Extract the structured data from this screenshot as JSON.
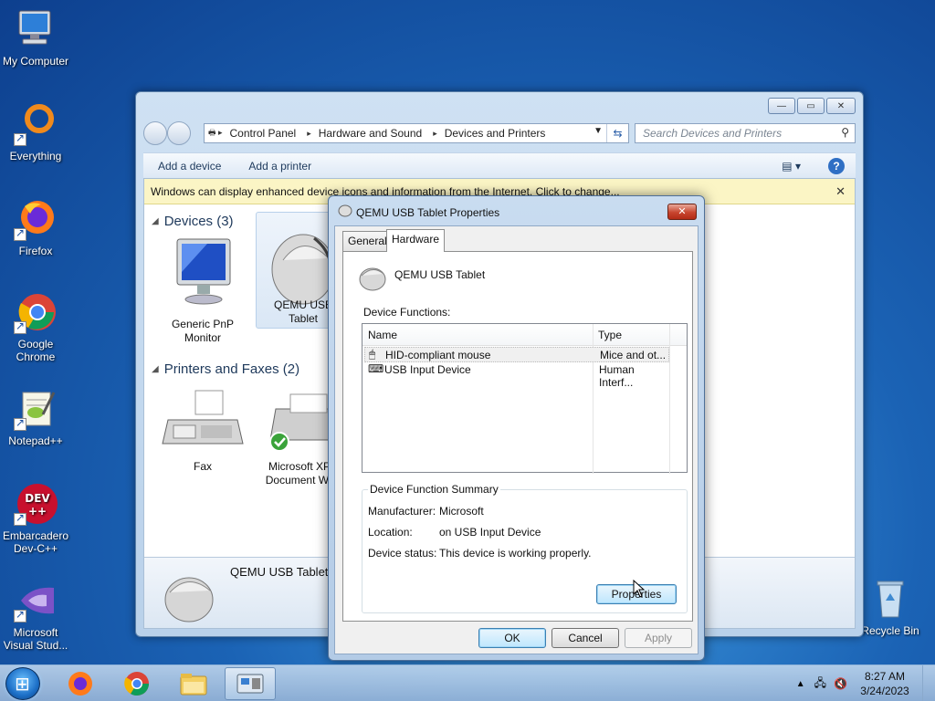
{
  "desktop": {
    "icons": [
      {
        "label": "My Computer"
      },
      {
        "label": "Everything"
      },
      {
        "label": "Firefox"
      },
      {
        "label": "Google Chrome"
      },
      {
        "label": "Notepad++"
      },
      {
        "label": "Embarcadero Dev-C++"
      },
      {
        "label": "Microsoft Visual Stud..."
      },
      {
        "label": "Recycle Bin"
      }
    ],
    "devcpp_logo_text": "DEV\n++"
  },
  "explorer": {
    "breadcrumb": [
      "Control Panel",
      "Hardware and Sound",
      "Devices and Printers"
    ],
    "search_placeholder": "Search Devices and Printers",
    "commands": {
      "add_device": "Add a device",
      "add_printer": "Add a printer"
    },
    "infobar": "Windows can display enhanced device icons and information from the Internet. Click to change...",
    "groups": {
      "devices": {
        "title": "Devices (3)",
        "items": [
          "Generic PnP Monitor",
          "QEMU USB Tablet"
        ]
      },
      "printers": {
        "title": "Printers and Faxes (2)",
        "items": [
          "Fax",
          "Microsoft XPS Document Wr..."
        ]
      }
    },
    "details_name": "QEMU USB Tablet"
  },
  "dialog": {
    "title": "QEMU USB Tablet Properties",
    "tabs": [
      "General",
      "Hardware"
    ],
    "active_tab": "Hardware",
    "device_name": "QEMU USB Tablet",
    "functions_label": "Device Functions:",
    "columns": [
      "Name",
      "Type"
    ],
    "rows": [
      {
        "name": "HID-compliant mouse",
        "type": "Mice and ot..."
      },
      {
        "name": "USB Input Device",
        "type": "Human Interf..."
      }
    ],
    "summary": {
      "legend": "Device Function Summary",
      "manufacturer_label": "Manufacturer:",
      "manufacturer": "Microsoft",
      "location_label": "Location:",
      "location": "on USB Input Device",
      "status_label": "Device status:",
      "status": "This device is working properly."
    },
    "properties_btn": "Properties",
    "ok": "OK",
    "cancel": "Cancel",
    "apply": "Apply"
  },
  "taskbar": {
    "time": "8:27 AM",
    "date": "3/24/2023"
  }
}
